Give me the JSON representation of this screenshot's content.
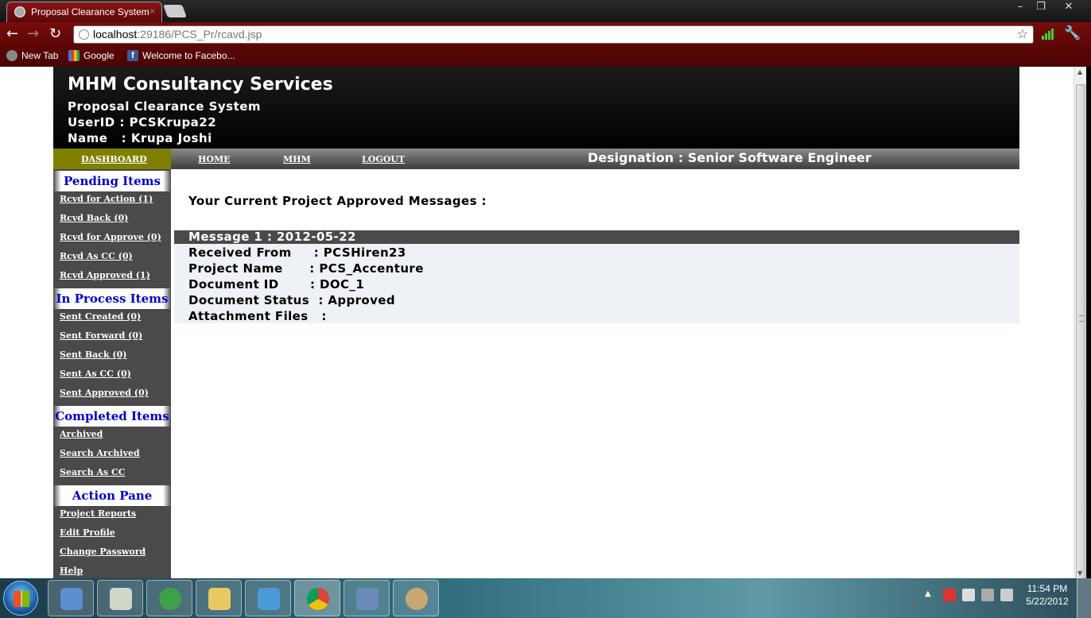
{
  "browser": {
    "tab_title": "Proposal Clearance System",
    "tab_close": "×",
    "url_host": "localhost",
    "url_path": ":29186/PCS_Pr/rcavd.jsp",
    "bookmarks": [
      "New Tab",
      "Google",
      "Welcome to Facebo..."
    ],
    "window_controls": {
      "minimize": "–",
      "maximize": "❐",
      "close": "✕"
    }
  },
  "header": {
    "brand": "MHM Consultancy Services",
    "system": "Proposal Clearance System",
    "userid": "UserID : PCSKrupa22",
    "name": "Name   : Krupa Joshi"
  },
  "nav": {
    "dashboard": "DASHBOARD",
    "home": "HOME",
    "mhm": "MHM",
    "logout": "LOGOUT",
    "designation": "Designation : Senior Software Engineer"
  },
  "sidebar": {
    "pending": {
      "title": "Pending Items",
      "items": [
        "Rcvd for Action (1)",
        "Rcvd Back (0)",
        "Rcvd for Approve (0)",
        "Rcvd As CC (0)",
        "Rcvd Approved (1)"
      ]
    },
    "in_process": {
      "title": "In Process Items",
      "items": [
        "Sent Created (0)",
        "Sent Forward (0)",
        "Sent Back (0)",
        "Sent As CC (0)",
        "Sent Approved (0)"
      ]
    },
    "completed": {
      "title": "Completed Items",
      "items": [
        "Archived",
        "Search Archived",
        "Search As CC"
      ]
    },
    "action": {
      "title": "Action Pane",
      "items": [
        "Project Reports",
        "Edit Profile",
        "Change Password",
        "Help"
      ]
    }
  },
  "main": {
    "heading": "Your Current Project Approved Messages :",
    "message_title": "Message 1 : 2012-05-22",
    "rows": [
      "Received From     : PCSHiren23",
      "Project Name      : PCS_Accenture",
      "Document ID       : DOC_1",
      "Document Status  : Approved",
      "Attachment Files   :"
    ]
  },
  "taskbar": {
    "time": "11:54 PM",
    "date": "5/22/2012"
  },
  "colors": {
    "browser_frame": "#7a0c0c",
    "header_bg": "#000000",
    "dashboard_tab": "#808000",
    "sidebar_bg": "#4a4a4a",
    "section_title": "#0000cc",
    "message_body": "#eef2f7"
  }
}
